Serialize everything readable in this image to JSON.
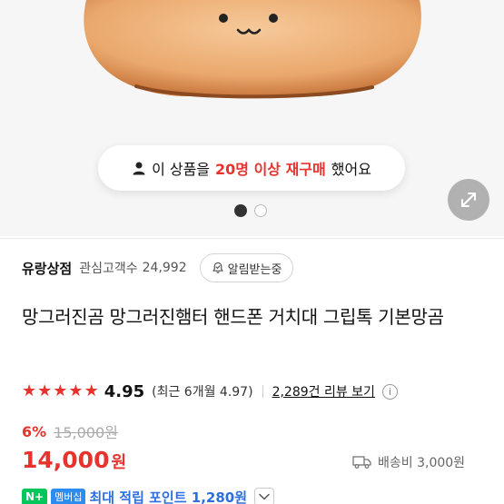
{
  "hero": {
    "rebuy_prefix": "이 상품을",
    "rebuy_highlight": "20명 이상 재구매",
    "rebuy_suffix": "했어요",
    "carousel_total": 2,
    "carousel_active": 1
  },
  "store": {
    "name": "유랑상점",
    "followers_label": "관심고객수",
    "followers_count": "24,992",
    "notify_label": "알림받는중"
  },
  "product": {
    "title": "망그러진곰 망그러진햄터 핸드폰 거치대 그립톡 기본망곰"
  },
  "rating": {
    "stars": 5,
    "value": "4.95",
    "recent": "(최근 6개월 4.97)",
    "review_link": "2,289건 리뷰 보기",
    "info_symbol": "i"
  },
  "price": {
    "discount_rate": "6%",
    "original": "15,000원",
    "current": "14,000",
    "unit": "원"
  },
  "shipping": {
    "label": "배송비 3,000원"
  },
  "points": {
    "npay_badge": "N+",
    "member_badge": "멤버십",
    "text": "최대 적립 포인트 1,280원"
  },
  "colors": {
    "accent_red": "#e8322e",
    "points_blue": "#2d6fe0",
    "npay_green": "#03c75a"
  }
}
